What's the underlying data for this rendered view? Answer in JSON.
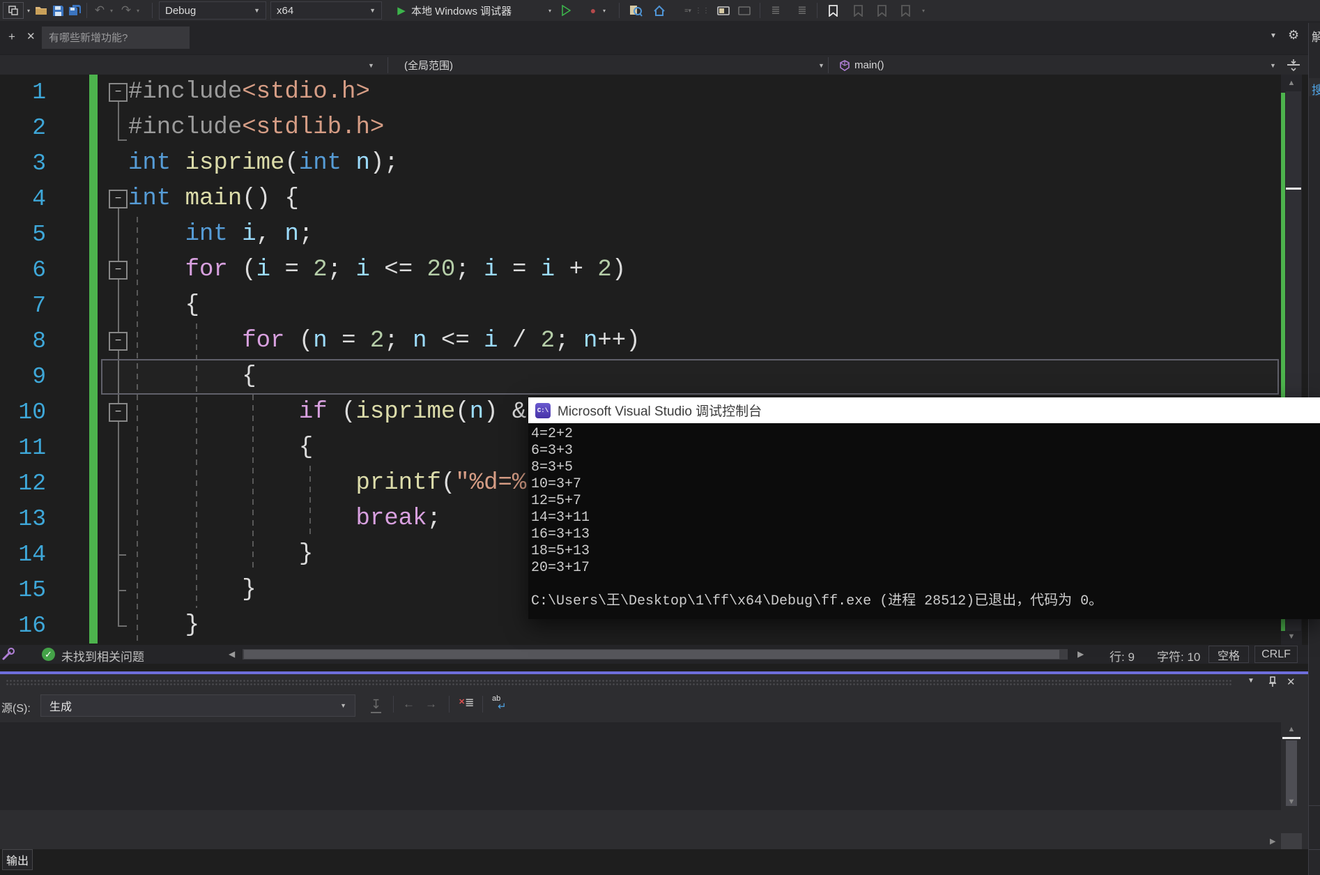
{
  "icons": {
    "dropdown": "▼",
    "close": "✕",
    "gear": "⚙",
    "pin": "+",
    "minus": "−",
    "left": "◀",
    "right": "▶",
    "up": "▲",
    "down": "▼",
    "check": "✓",
    "undo": "↶",
    "redo": "↷",
    "play": "▶",
    "circle": "●",
    "lines": "≣",
    "hamburger": "☰",
    "wrap_ab": "ab",
    "wrap_ret": "↵",
    "clear_x": "✕",
    "import_arrow": "↧",
    "arrow_l": "←",
    "arrow_r": "→"
  },
  "toolbar": {
    "debug_config": "Debug",
    "platform": "x64",
    "run_label": "本地 Windows 调试器"
  },
  "search_tab": {
    "placeholder": "有哪些新增功能?"
  },
  "navbar": {
    "scope_selected": "(全局范围)",
    "function_selected": "main()"
  },
  "editor": {
    "lines": [
      {
        "n": 1,
        "indent": 0,
        "fold": true,
        "tokens": [
          [
            "pp",
            "#include"
          ],
          [
            "str",
            "<stdio.h>"
          ]
        ]
      },
      {
        "n": 2,
        "indent": 0,
        "tokens": [
          [
            "pp",
            "#include"
          ],
          [
            "str",
            "<stdlib.h>"
          ]
        ]
      },
      {
        "n": 3,
        "indent": 0,
        "tokens": [
          [
            "kw",
            "int"
          ],
          [
            "pun",
            " "
          ],
          [
            "fn",
            "isprime"
          ],
          [
            "pun",
            "("
          ],
          [
            "kw",
            "int"
          ],
          [
            "var",
            " n"
          ],
          [
            "pun",
            ");"
          ]
        ]
      },
      {
        "n": 4,
        "indent": 0,
        "fold": true,
        "tokens": [
          [
            "kw",
            "int"
          ],
          [
            "pun",
            " "
          ],
          [
            "fn",
            "main"
          ],
          [
            "pun",
            "() {"
          ]
        ]
      },
      {
        "n": 5,
        "indent": 4,
        "tokens": [
          [
            "kw",
            "int"
          ],
          [
            "pun",
            " "
          ],
          [
            "var",
            "i"
          ],
          [
            "pun",
            ", "
          ],
          [
            "var",
            "n"
          ],
          [
            "pun",
            ";"
          ]
        ]
      },
      {
        "n": 6,
        "indent": 4,
        "fold": true,
        "tokens": [
          [
            "ctl",
            "for"
          ],
          [
            "pun",
            " ("
          ],
          [
            "var",
            "i"
          ],
          [
            "pun",
            " = "
          ],
          [
            "num",
            "2"
          ],
          [
            "pun",
            "; "
          ],
          [
            "var",
            "i"
          ],
          [
            "pun",
            " <= "
          ],
          [
            "num",
            "20"
          ],
          [
            "pun",
            "; "
          ],
          [
            "var",
            "i"
          ],
          [
            "pun",
            " = "
          ],
          [
            "var",
            "i"
          ],
          [
            "pun",
            " + "
          ],
          [
            "num",
            "2"
          ],
          [
            "pun",
            ")"
          ]
        ]
      },
      {
        "n": 7,
        "indent": 4,
        "tokens": [
          [
            "pun",
            "{"
          ]
        ]
      },
      {
        "n": 8,
        "indent": 8,
        "fold": true,
        "tokens": [
          [
            "ctl",
            "for"
          ],
          [
            "pun",
            " ("
          ],
          [
            "var",
            "n"
          ],
          [
            "pun",
            " = "
          ],
          [
            "num",
            "2"
          ],
          [
            "pun",
            "; "
          ],
          [
            "var",
            "n"
          ],
          [
            "pun",
            " <= "
          ],
          [
            "var",
            "i"
          ],
          [
            "pun",
            " / "
          ],
          [
            "num",
            "2"
          ],
          [
            "pun",
            "; "
          ],
          [
            "var",
            "n"
          ],
          [
            "pun",
            "++)"
          ]
        ]
      },
      {
        "n": 9,
        "indent": 8,
        "current": true,
        "tokens": [
          [
            "pun",
            "{"
          ]
        ]
      },
      {
        "n": 10,
        "indent": 12,
        "fold": true,
        "tokens": [
          [
            "ctl",
            "if"
          ],
          [
            "pun",
            " ("
          ],
          [
            "fn",
            "isprime"
          ],
          [
            "pun",
            "("
          ],
          [
            "var",
            "n"
          ],
          [
            "pun",
            ") &"
          ]
        ]
      },
      {
        "n": 11,
        "indent": 12,
        "tokens": [
          [
            "pun",
            "{"
          ]
        ]
      },
      {
        "n": 12,
        "indent": 16,
        "tokens": [
          [
            "fn",
            "printf"
          ],
          [
            "pun",
            "("
          ],
          [
            "str",
            "\"%d=%"
          ]
        ]
      },
      {
        "n": 13,
        "indent": 16,
        "tokens": [
          [
            "ctl",
            "break"
          ],
          [
            "pun",
            ";"
          ]
        ]
      },
      {
        "n": 14,
        "indent": 12,
        "tokens": [
          [
            "pun",
            "}"
          ]
        ]
      },
      {
        "n": 15,
        "indent": 8,
        "tokens": [
          [
            "pun",
            "}"
          ]
        ]
      },
      {
        "n": 16,
        "indent": 4,
        "tokens": [
          [
            "pun",
            "}"
          ]
        ]
      }
    ]
  },
  "console": {
    "icon_label": "C:\\",
    "title": "Microsoft Visual Studio 调试控制台",
    "lines": [
      "4=2+2",
      "6=3+3",
      "8=3+5",
      "10=3+7",
      "12=5+7",
      "14=3+11",
      "16=3+13",
      "18=5+13",
      "20=3+17"
    ],
    "exit_line": "C:\\Users\\王\\Desktop\\1\\ff\\x64\\Debug\\ff.exe (进程 28512)已退出，代码为 0。"
  },
  "status_row": {
    "health_text": "未找到相关问题",
    "line_label": "行: 9",
    "col_label": "字符: 10",
    "spaces_label": "空格",
    "eol_label": "CRLF"
  },
  "output_panel": {
    "source_label": "源(S):",
    "source_value": "生成",
    "tab_label": "输出"
  },
  "right_strip": {
    "top_label": "解",
    "mid_label": "搜"
  }
}
